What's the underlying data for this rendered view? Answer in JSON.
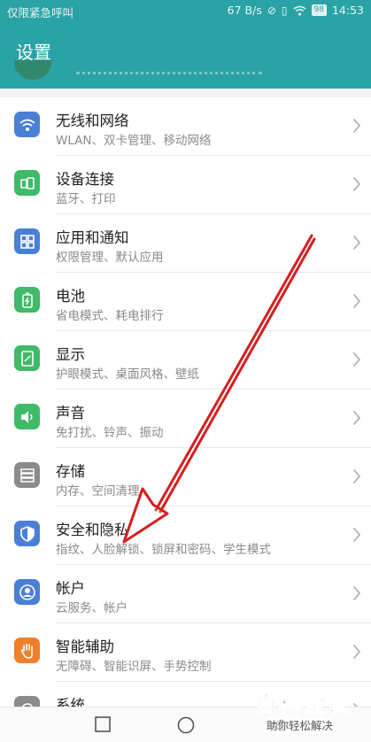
{
  "status_bar": {
    "left_text": "仅限紧急呼叫",
    "net_speed": "67 B/s",
    "battery": "98",
    "time": "14:53"
  },
  "header": {
    "title": "设置"
  },
  "settings": [
    {
      "title": "无线和网络",
      "subtitle": "WLAN、双卡管理、移动网络",
      "icon": "wifi-icon",
      "color": "#4a7fd6"
    },
    {
      "title": "设备连接",
      "subtitle": "蓝牙、打印",
      "icon": "device-connection-icon",
      "color": "#3fba68"
    },
    {
      "title": "应用和通知",
      "subtitle": "权限管理、默认应用",
      "icon": "apps-icon",
      "color": "#4a7fd6"
    },
    {
      "title": "电池",
      "subtitle": "省电模式、耗电排行",
      "icon": "battery-icon",
      "color": "#3fba68"
    },
    {
      "title": "显示",
      "subtitle": "护眼模式、桌面风格、壁纸",
      "icon": "display-icon",
      "color": "#3fba68"
    },
    {
      "title": "声音",
      "subtitle": "免打扰、铃声、振动",
      "icon": "sound-icon",
      "color": "#3fba68"
    },
    {
      "title": "存储",
      "subtitle": "内存、空间清理",
      "icon": "storage-icon",
      "color": "#8b8b8b"
    },
    {
      "title": "安全和隐私",
      "subtitle": "指纹、人脸解锁、锁屏和密码、学生模式",
      "icon": "shield-icon",
      "color": "#4a7fd6"
    },
    {
      "title": "帐户",
      "subtitle": "云服务、帐户",
      "icon": "account-icon",
      "color": "#4a7fd6"
    },
    {
      "title": "智能辅助",
      "subtitle": "无障碍、智能识屏、手势控制",
      "icon": "hand-icon",
      "color": "#f07f2a"
    },
    {
      "title": "系统",
      "subtitle": "",
      "icon": "system-icon",
      "color": "#8b8b8b"
    }
  ],
  "watermark": {
    "brand": "百科全说",
    "tagline": "助你轻松解决"
  }
}
